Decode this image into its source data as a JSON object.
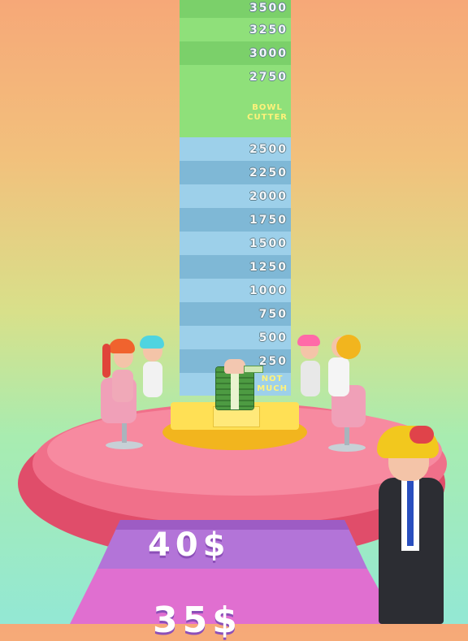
{
  "tower": {
    "segments": [
      {
        "label": "3500",
        "kind": "value",
        "color": "green",
        "shade": "b"
      },
      {
        "label": "3250",
        "kind": "value",
        "color": "green",
        "shade": "a"
      },
      {
        "label": "3000",
        "kind": "value",
        "color": "green",
        "shade": "b"
      },
      {
        "label": "2750",
        "kind": "value",
        "color": "green",
        "shade": "a"
      },
      {
        "label": "BOWL\nCUTTER",
        "kind": "tag",
        "color": "green",
        "shade": "a"
      },
      {
        "label": "2500",
        "kind": "value",
        "color": "blue",
        "shade": "a"
      },
      {
        "label": "2250",
        "kind": "value",
        "color": "blue",
        "shade": "b"
      },
      {
        "label": "2000",
        "kind": "value",
        "color": "blue",
        "shade": "a"
      },
      {
        "label": "1750",
        "kind": "value",
        "color": "blue",
        "shade": "b"
      },
      {
        "label": "1500",
        "kind": "value",
        "color": "blue",
        "shade": "a"
      },
      {
        "label": "1250",
        "kind": "value",
        "color": "blue",
        "shade": "b"
      },
      {
        "label": "1000",
        "kind": "value",
        "color": "blue",
        "shade": "a"
      },
      {
        "label": "750",
        "kind": "value",
        "color": "blue",
        "shade": "b"
      },
      {
        "label": "500",
        "kind": "value",
        "color": "blue",
        "shade": "a"
      },
      {
        "label": "250",
        "kind": "value",
        "color": "blue",
        "shade": "b"
      },
      {
        "label": "NOT\nMUCH",
        "kind": "tag",
        "color": "blue",
        "shade": "a"
      }
    ]
  },
  "floor": {
    "price_near": "40$",
    "price_far": "35$"
  },
  "colors": {
    "platform": "#f0708a",
    "pedestal": "#ffe055",
    "tile_purple": "#b374d8",
    "tile_pink": "#e06fd0"
  },
  "icons": {
    "money": "money-stack-icon"
  }
}
